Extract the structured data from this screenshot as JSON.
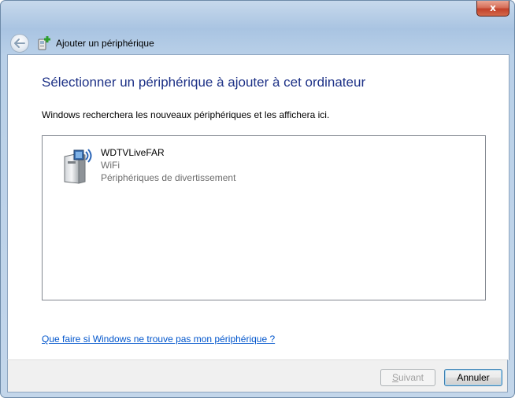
{
  "window": {
    "title": "Ajouter un périphérique",
    "close_label": "x"
  },
  "page": {
    "heading": "Sélectionner un périphérique à ajouter à cet ordinateur",
    "description": "Windows recherchera les nouveaux périphériques et les affichera ici."
  },
  "devices": [
    {
      "name": "WDTVLiveFAR",
      "connection": "WiFi",
      "category": "Périphériques de divertissement",
      "icon": "media-device-icon"
    }
  ],
  "help_link": "Que faire si Windows ne trouve pas mon périphérique ?",
  "buttons": {
    "next_first": "S",
    "next_rest": "uivant",
    "cancel": "Annuler"
  },
  "colors": {
    "heading": "#1e3287",
    "link": "#0055cc",
    "close_button": "#c2412a"
  }
}
